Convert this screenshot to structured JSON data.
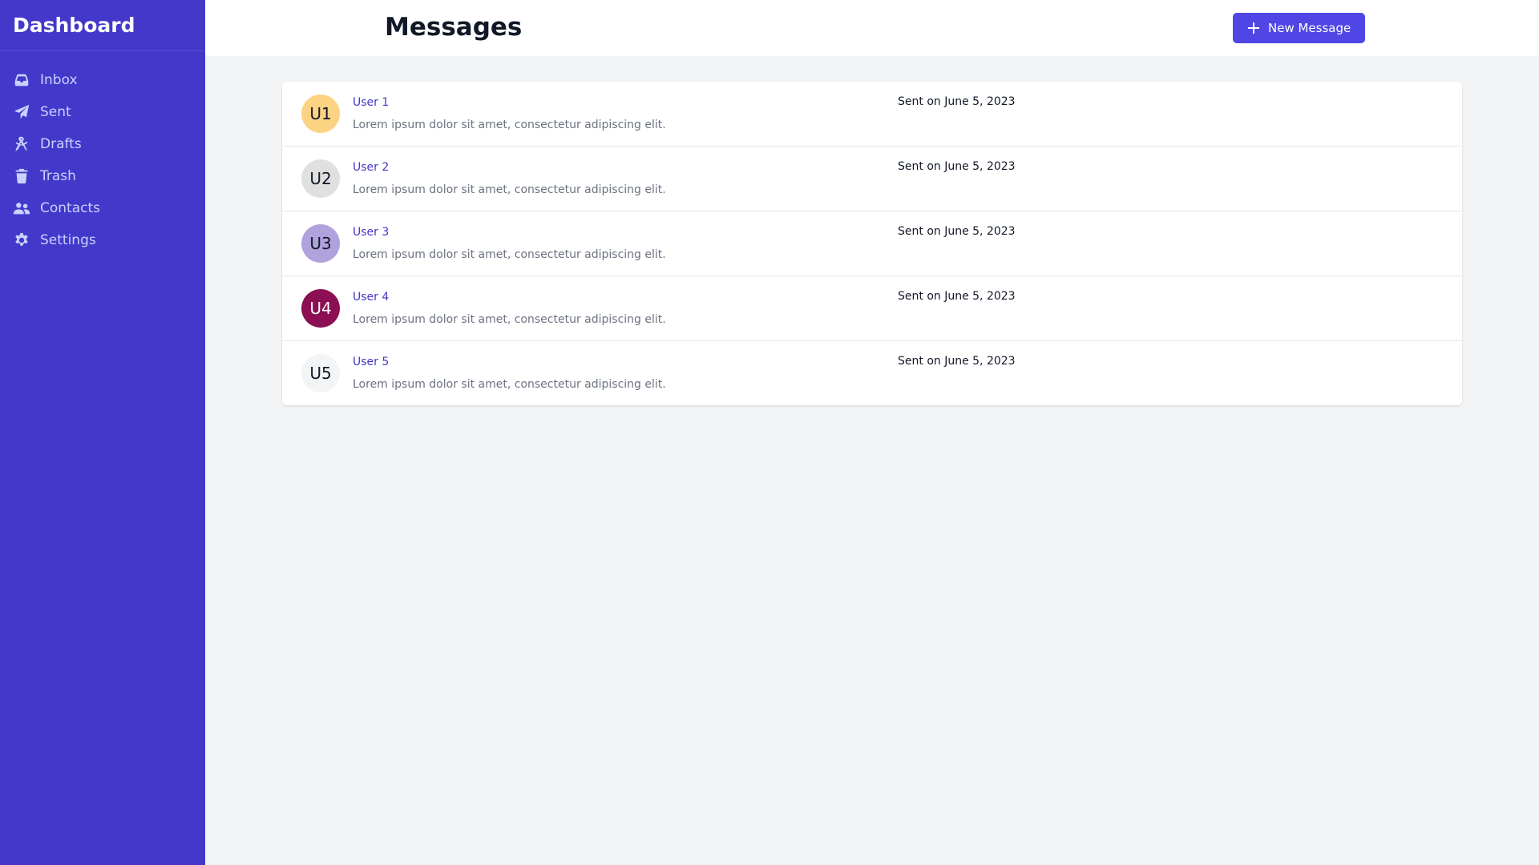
{
  "sidebar": {
    "title": "Dashboard",
    "items": [
      {
        "label": "Inbox",
        "icon": "inbox-icon"
      },
      {
        "label": "Sent",
        "icon": "paper-plane-icon"
      },
      {
        "label": "Drafts",
        "icon": "drafting-compass-icon"
      },
      {
        "label": "Trash",
        "icon": "trash-icon"
      },
      {
        "label": "Contacts",
        "icon": "users-icon"
      },
      {
        "label": "Settings",
        "icon": "gear-icon"
      }
    ]
  },
  "header": {
    "title": "Messages",
    "new_button_label": "New Message"
  },
  "messages": [
    {
      "initials": "U1",
      "sender": "User 1",
      "snippet": "Lorem ipsum dolor sit amet, consectetur adipiscing elit.",
      "sent": "Sent on June 5, 2023",
      "avatar_bg": "#fcd383",
      "avatar_fg": "#111827"
    },
    {
      "initials": "U2",
      "sender": "User 2",
      "snippet": "Lorem ipsum dolor sit amet, consectetur adipiscing elit.",
      "sent": "Sent on June 5, 2023",
      "avatar_bg": "#e0e0e0",
      "avatar_fg": "#111827"
    },
    {
      "initials": "U3",
      "sender": "User 3",
      "snippet": "Lorem ipsum dolor sit amet, consectetur adipiscing elit.",
      "sent": "Sent on June 5, 2023",
      "avatar_bg": "#b0a2dc",
      "avatar_fg": "#111827"
    },
    {
      "initials": "U4",
      "sender": "User 4",
      "snippet": "Lorem ipsum dolor sit amet, consectetur adipiscing elit.",
      "sent": "Sent on June 5, 2023",
      "avatar_bg": "#8b0f52",
      "avatar_fg": "#ffffff"
    },
    {
      "initials": "U5",
      "sender": "User 5",
      "snippet": "Lorem ipsum dolor sit amet, consectetur adipiscing elit.",
      "sent": "Sent on June 5, 2023",
      "avatar_bg": "#f3f4f6",
      "avatar_fg": "#111827"
    }
  ],
  "colors": {
    "sidebar_bg": "#4338ca",
    "accent": "#4f46e5",
    "page_bg": "#f3f4f6"
  }
}
